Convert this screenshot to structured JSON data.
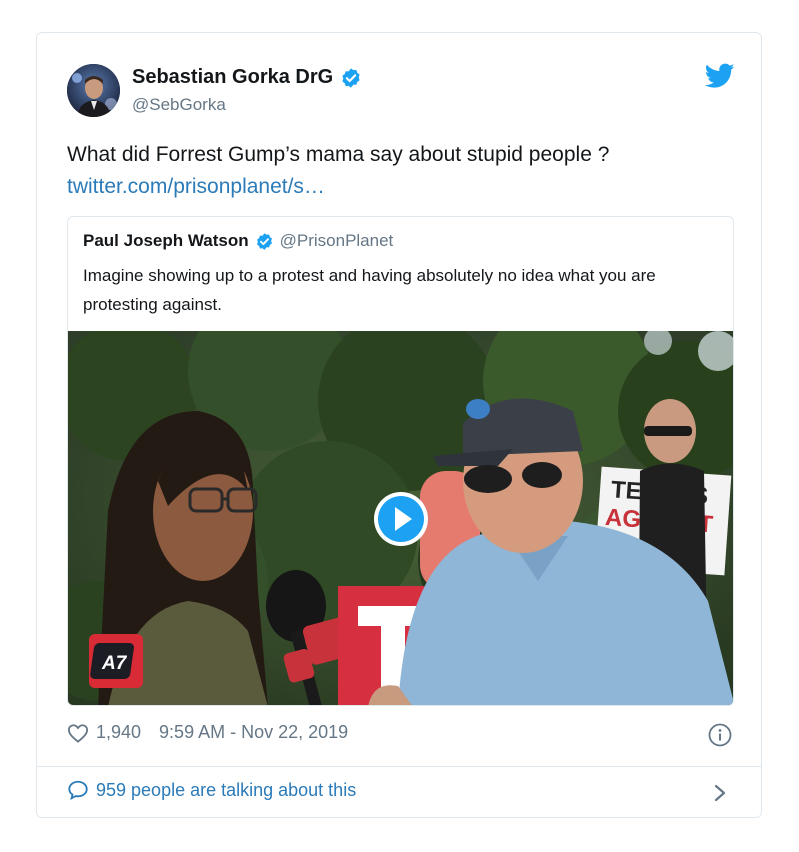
{
  "tweet": {
    "author_name": "Sebastian Gorka DrG",
    "author_handle": "@SebGorka",
    "text": "What did Forrest Gump’s mama say about stupid people ?",
    "link": "twitter.com/prisonplanet/s…",
    "likes": "1,940",
    "timestamp": "9:59 AM - Nov 22, 2019",
    "talking": "959 people are talking about this"
  },
  "quote": {
    "author_name": "Paul Joseph Watson",
    "author_handle": "@PrisonPlanet",
    "text": "Imagine showing up to a protest and having absolutely no idea what you are protesting against.",
    "sign_text_line1": "TEXANS",
    "sign_text_line2": "AGAINST",
    "logo_text": "A7"
  },
  "icons": {
    "verified": "verified-badge-icon",
    "brand": "twitter-bird-icon",
    "like": "heart-icon",
    "info": "info-icon",
    "reply": "speech-bubble-icon",
    "chevron": "chevron-right-icon",
    "play": "play-icon"
  },
  "colors": {
    "accent": "#2b7bb9",
    "verified": "#1da1f2",
    "text_primary": "#14171a",
    "text_secondary": "#657786",
    "border": "#e1e8ed"
  }
}
